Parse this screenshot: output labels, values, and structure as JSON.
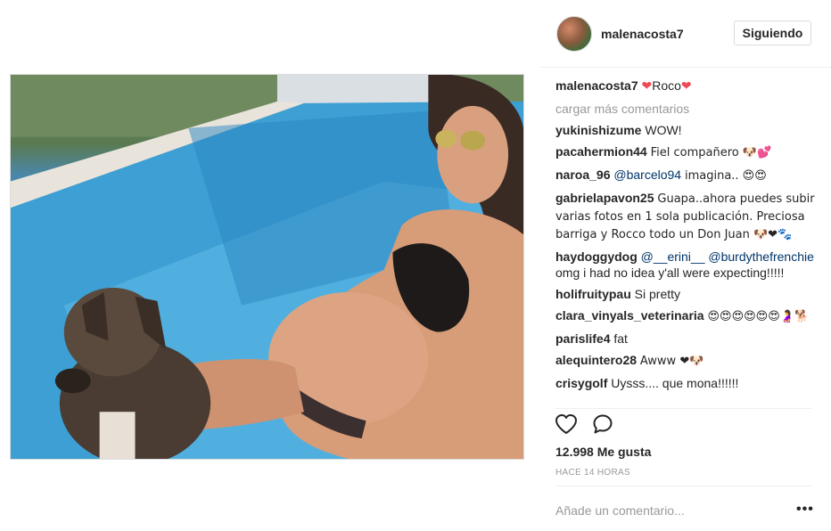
{
  "post": {
    "username": "malenacosta7",
    "follow_label": "Siguiendo",
    "caption": {
      "user": "malenacosta7",
      "text": "Roco"
    },
    "load_more": "cargar más comentarios",
    "comments": [
      {
        "user": "yukinishizume",
        "text": "WOW!"
      },
      {
        "user": "pacahermion44",
        "text": "Fiel compañero 🐶💕"
      },
      {
        "user": "naroa_96",
        "mention": "@barcelo94",
        "text": "imagina.. 😍😍"
      },
      {
        "user": "gabrielapavon25",
        "text": "Guapa..ahora puedes subir varias fotos en 1 sola publicación. Preciosa barriga y Rocco todo un Don Juan 🐶❤🐾"
      },
      {
        "user": "haydoggydog",
        "mention": "@__erini__ @burdythefrenchie",
        "text": "omg i had no idea y'all were expecting!!!!!"
      },
      {
        "user": "holifruitypau",
        "text": "Si pretty"
      },
      {
        "user": "clara_vinyals_veterinaria",
        "text": "😍😍😍😍😍😍🤰🐕"
      },
      {
        "user": "parislife4",
        "text": "fat"
      },
      {
        "user": "alequintero28",
        "text": "Awww ❤🐶"
      },
      {
        "user": "crisygolf",
        "text": "Uysss.... que mona!!!!!!"
      }
    ],
    "likes": "12.998 Me gusta",
    "timestamp": "HACE 14 HORAS",
    "add_comment_placeholder": "Añade un comentario...",
    "more_options": "•••"
  },
  "icons": {
    "like": "heart-outline-icon",
    "comment": "speech-bubble-icon",
    "options": "ellipsis-icon"
  },
  "colors": {
    "text": "#262626",
    "muted": "#999999",
    "mention": "#003569",
    "heart": "#ed4956",
    "border": "#dbdbdb"
  }
}
